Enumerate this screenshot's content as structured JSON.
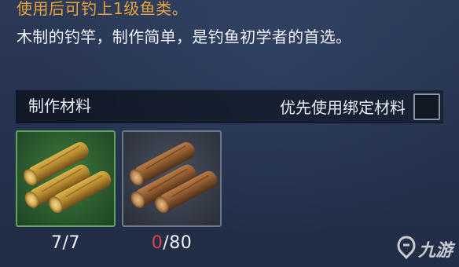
{
  "item": {
    "effect_text": "使用后可钓上1级鱼类。",
    "description": "木制的钓竿，制作简单，是钓鱼初学者的首选。"
  },
  "materials": {
    "header_label": "制作材料",
    "bind_pref_label": "优先使用绑定材料",
    "bind_pref_checked": false,
    "slots": [
      {
        "icon": "wood-logs-icon",
        "owned": "7",
        "separator": "/",
        "required": "7",
        "frame_color": "#5fa35c"
      },
      {
        "icon": "wood-logs-icon",
        "owned": "0",
        "separator": "/",
        "required": "80",
        "frame_color": "#6e7787",
        "owned_color": "#e0424a"
      }
    ]
  },
  "watermark": {
    "icon": "jiuyou-logo-icon",
    "text": "九游"
  }
}
